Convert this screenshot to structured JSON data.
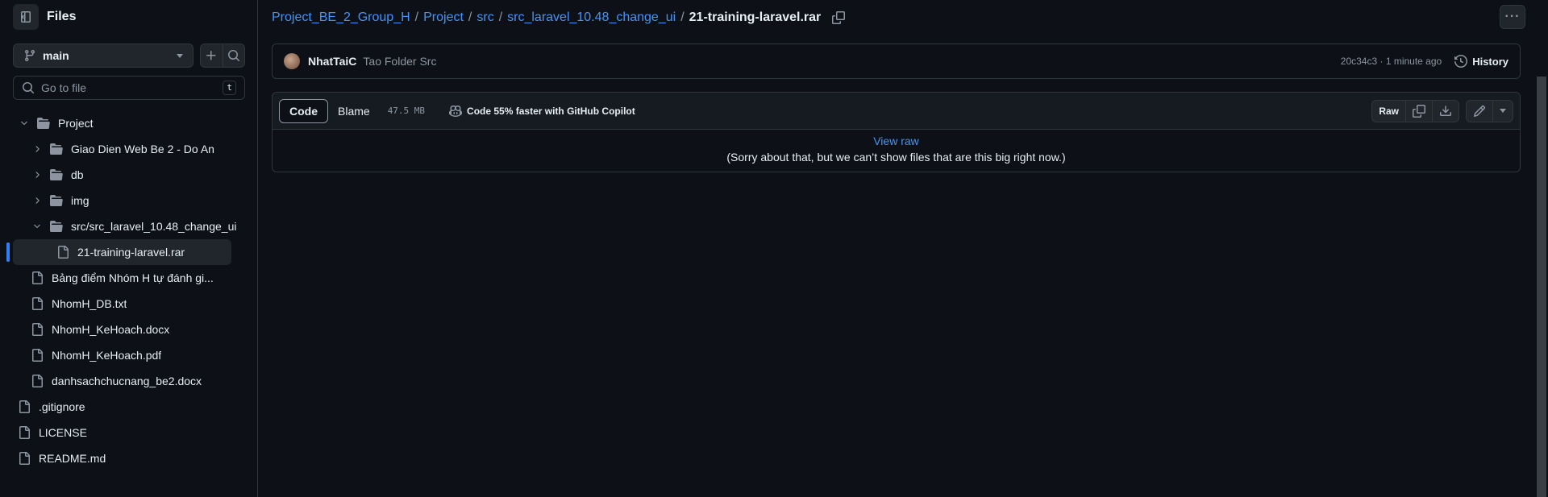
{
  "sidebar": {
    "title": "Files",
    "branch": "main",
    "goto_placeholder": "Go to file",
    "goto_shortcut": "t",
    "tree": [
      {
        "label": "Project",
        "type": "folder",
        "depth": 0,
        "expanded": true
      },
      {
        "label": "Giao Dien Web Be 2 - Do An",
        "type": "folder",
        "depth": 1,
        "expanded": false
      },
      {
        "label": "db",
        "type": "folder",
        "depth": 1,
        "expanded": false
      },
      {
        "label": "img",
        "type": "folder",
        "depth": 1,
        "expanded": false
      },
      {
        "label": "src/src_laravel_10.48_change_ui",
        "type": "folder",
        "depth": 1,
        "expanded": true
      },
      {
        "label": "21-training-laravel.rar",
        "type": "file",
        "depth": 2,
        "selected": true
      },
      {
        "label": "Bảng điểm Nhóm H tự đánh gi...",
        "type": "file",
        "depth": 1
      },
      {
        "label": "NhomH_DB.txt",
        "type": "file",
        "depth": 1
      },
      {
        "label": "NhomH_KeHoach.docx",
        "type": "file",
        "depth": 1
      },
      {
        "label": "NhomH_KeHoach.pdf",
        "type": "file",
        "depth": 1
      },
      {
        "label": "danhsachchucnang_be2.docx",
        "type": "file",
        "depth": 1
      },
      {
        "label": ".gitignore",
        "type": "file",
        "depth": 0
      },
      {
        "label": "LICENSE",
        "type": "file",
        "depth": 0
      },
      {
        "label": "README.md",
        "type": "file",
        "depth": 0
      }
    ]
  },
  "breadcrumb": {
    "items": [
      "Project_BE_2_Group_H",
      "Project",
      "src",
      "src_laravel_10.48_change_ui"
    ],
    "separator": "/",
    "current": "21-training-laravel.rar"
  },
  "commit": {
    "author": "NhatTaiC",
    "message": "Tao Folder Src",
    "meta": "20c34c3 · 1 minute ago",
    "history_label": "History"
  },
  "file": {
    "tabs": [
      "Code",
      "Blame"
    ],
    "active_tab": "Code",
    "size": "47.5 MB",
    "copilot_text": "Code 55% faster with GitHub Copilot",
    "raw_label": "Raw",
    "view_raw": "View raw",
    "message": "(Sorry about that, but we can’t show files that are this big right now.)"
  },
  "colors": {
    "background": "#0d1117",
    "link": "#4493f8",
    "accent_bar": "#2f81f7",
    "border": "#30363d"
  }
}
